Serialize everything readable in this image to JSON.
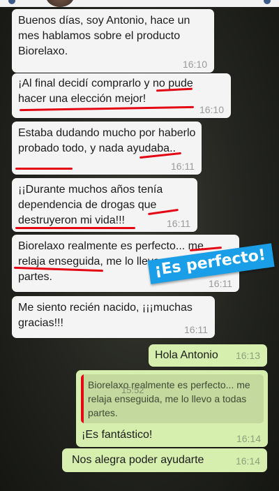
{
  "chat": {
    "messages": [
      {
        "text": "Buenos días, soy Antonio, hace un mes hablamos sobre el producto Biorelaxo.",
        "time": "16:10"
      },
      {
        "text": "¡Al final decidí comprarlo y no pude hacer una elección mejor!",
        "time": "16:10"
      },
      {
        "text": "Estaba dudando mucho por haberlo probado todo, y nada ayudaba..",
        "time": "16:11"
      },
      {
        "text": "¡¡Durante muchos años tenía dependencia de drogas que destruyeron mi vida!!!",
        "time": "16:11"
      },
      {
        "text": "Biorelaxo realmente es perfecto... me relaja enseguida, me lo llevo a todas partes.",
        "time": "16:11"
      },
      {
        "text": "Me siento recién nacido, ¡¡¡muchas gracias!!!",
        "time": "16:11"
      },
      {
        "text": "Hola Antonio",
        "time": "16:13"
      },
      {
        "text": "¡Es fantástico!",
        "time": "16:14",
        "quoted_text": "Biorelaxo realmente es perfecto... me relaja enseguida, me lo llevo a todas partes.",
        "quoted_time": "15:52"
      },
      {
        "text": "Nos alegra poder ayudarte",
        "time": "16:14"
      }
    ]
  },
  "overlay": {
    "stamp_text": "¡Es perfecto!"
  },
  "colors": {
    "incoming_bubble": "#f4f4f4",
    "outgoing_bubble": "#d6efae",
    "highlight_underline": "#e40613",
    "stamp_background": "#1a9ee8"
  }
}
